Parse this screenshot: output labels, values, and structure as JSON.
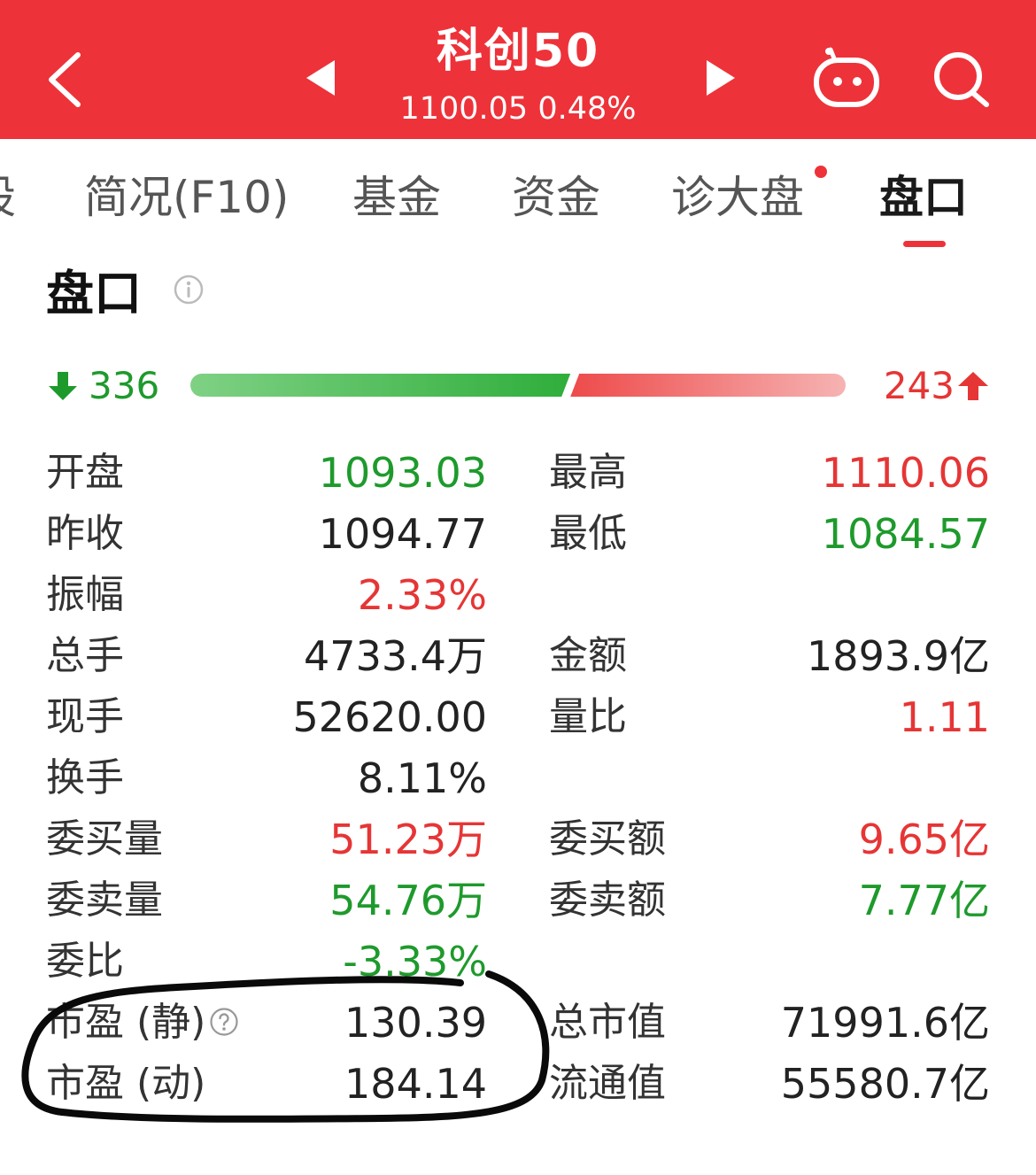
{
  "header": {
    "title": "科创50",
    "subtitle": "1100.05 0.48%"
  },
  "tabs": [
    {
      "label": "股"
    },
    {
      "label": "简况(F10)"
    },
    {
      "label": "基金"
    },
    {
      "label": "资金"
    },
    {
      "label": "诊大盘"
    },
    {
      "label": "盘口"
    }
  ],
  "section": {
    "title": "盘口"
  },
  "breadth": {
    "down_count": "336",
    "up_count": "243",
    "down_share": 0.58
  },
  "stats": {
    "open": {
      "label": "开盘",
      "value": "1093.03"
    },
    "high": {
      "label": "最高",
      "value": "1110.06"
    },
    "prev_close": {
      "label": "昨收",
      "value": "1094.77"
    },
    "low": {
      "label": "最低",
      "value": "1084.57"
    },
    "amplitude": {
      "label": "振幅",
      "value": "2.33%"
    },
    "volume": {
      "label": "总手",
      "value": "4733.4万"
    },
    "turnover_amount": {
      "label": "金额",
      "value": "1893.9亿"
    },
    "current_volume": {
      "label": "现手",
      "value": "52620.00"
    },
    "volume_ratio": {
      "label": "量比",
      "value": "1.11"
    },
    "turnover_rate": {
      "label": "换手",
      "value": "8.11%"
    },
    "bid_volume": {
      "label": "委买量",
      "value": "51.23万"
    },
    "bid_amount": {
      "label": "委买额",
      "value": "9.65亿"
    },
    "ask_volume": {
      "label": "委卖量",
      "value": "54.76万"
    },
    "ask_amount": {
      "label": "委卖额",
      "value": "7.77亿"
    },
    "order_ratio": {
      "label": "委比",
      "value": "-3.33%"
    },
    "pe_static": {
      "label": "市盈 (静)",
      "value": "130.39"
    },
    "market_cap": {
      "label": "总市值",
      "value": "71991.6亿"
    },
    "pe_dynamic": {
      "label": "市盈 (动)",
      "value": "184.14"
    },
    "float_cap": {
      "label": "流通值",
      "value": "55580.7亿"
    }
  },
  "colors": {
    "brand_red": "#ee3239",
    "up_red": "#e63535",
    "down_green": "#1e9a2c",
    "neutral": "#222222"
  }
}
